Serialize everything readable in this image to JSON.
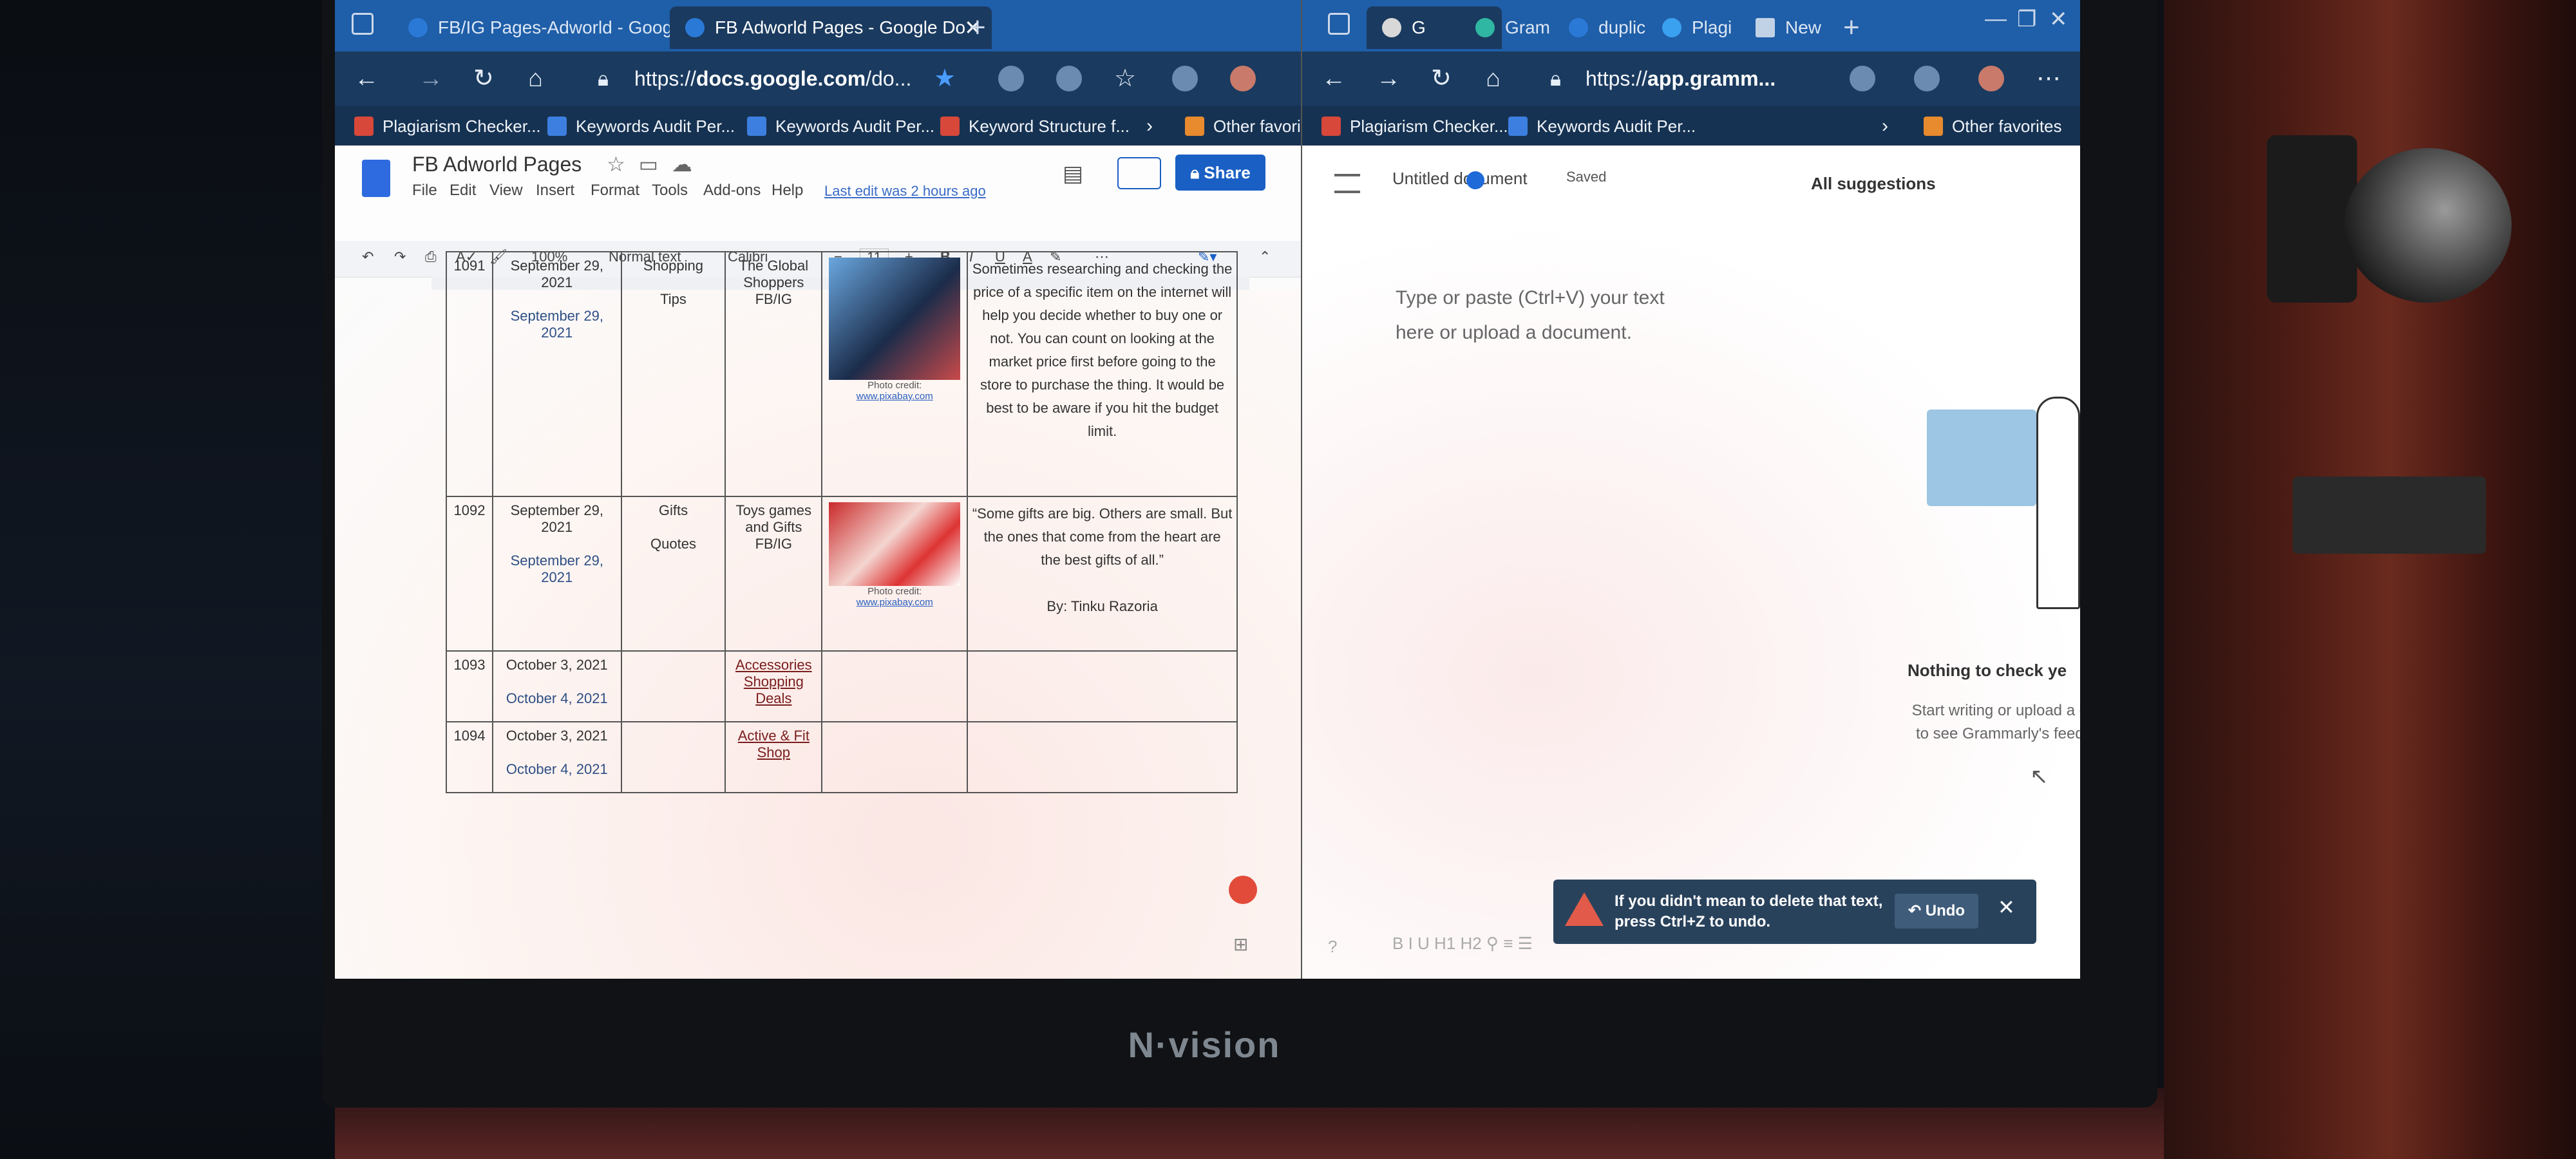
{
  "monitor": {
    "brand": "N·vision"
  },
  "left_browser": {
    "tabs": [
      {
        "label": "FB/IG Pages-Adworld - Google S",
        "active": false
      },
      {
        "label": "FB Adworld Pages - Google Do",
        "active": true
      }
    ],
    "url": {
      "scheme": "https://",
      "host": "docs.google.com",
      "rest": "/do..."
    },
    "bookmarks": [
      "Plagiarism Checker...",
      "Keywords Audit Per...",
      "Keywords Audit Per...",
      "Keyword Structure f...",
      "Other favori"
    ],
    "doc": {
      "title": "FB Adworld Pages",
      "menus": [
        "File",
        "Edit",
        "View",
        "Insert",
        "Format",
        "Tools",
        "Add-ons",
        "Help"
      ],
      "last_edit": "Last edit was 2 hours ago",
      "share_label": "Share",
      "toolbar": {
        "zoom": "100%",
        "style": "Normal text",
        "font": "Calibri",
        "size": "11"
      },
      "rows": [
        {
          "id": "1091",
          "date1": "September 29, 2021",
          "date2": "September 29, 2021",
          "cat1": "Shopping",
          "cat2": "Tips",
          "page": "The Global Shoppers FB/IG",
          "photo_credit": "Photo credit:",
          "photo_link": "www.pixabay.com",
          "text": "Sometimes researching and checking the price of a specific item on the internet will help you decide whether to buy one or not. You can count on looking at the market price first before going to the store to purchase the thing. It would be best to be aware if you hit the budget limit."
        },
        {
          "id": "1092",
          "date1": "September 29, 2021",
          "date2": "September 29, 2021",
          "cat1": "Gifts",
          "cat2": "Quotes",
          "page": "Toys games and Gifts FB/IG",
          "photo_credit": "Photo credit:",
          "photo_link": "www.pixabay.com",
          "text": "“Some gifts are big. Others are small. But the ones that come from the heart are the best gifts of all.”",
          "byline": "By: Tinku Razoria"
        },
        {
          "id": "1093",
          "date1": "October 3, 2021",
          "date2": "October 4, 2021",
          "page_link": "Accessories Shopping Deals"
        },
        {
          "id": "1094",
          "date1": "October 3, 2021",
          "date2": "October 4, 2021",
          "page_link": "Active & Fit Shop"
        }
      ]
    }
  },
  "right_browser": {
    "tabs": [
      "G",
      "Gram",
      "duplic",
      "Plagi",
      "New"
    ],
    "url": {
      "scheme": "https://",
      "host": "app.gramm..."
    },
    "bookmarks": [
      "Plagiarism Checker...",
      "Keywords Audit Per...",
      "Other favorites"
    ],
    "grammarly": {
      "doc_title": "Untitled document",
      "saved": "Saved",
      "all_suggestions": "All suggestions",
      "placeholder_line1": "Type or paste (Ctrl+V) your text",
      "placeholder_line2": "here or upload a document.",
      "nothing_title": "Nothing to check ye",
      "start_line1": "Start writing or upload a do",
      "start_line2": "to see Grammarly's feedb",
      "toast_text": "If you didn't mean to delete that text, press Ctrl+Z to undo.",
      "undo_label": "Undo",
      "format_bar": "B  I  U  H1  H2  ⚲  ≡  ☰"
    }
  },
  "colors": {
    "tab_bar": "#1f5ea8",
    "address_bar": "#1a3a5f",
    "share_button": "#1a5fc4",
    "toast": "#29425c"
  }
}
